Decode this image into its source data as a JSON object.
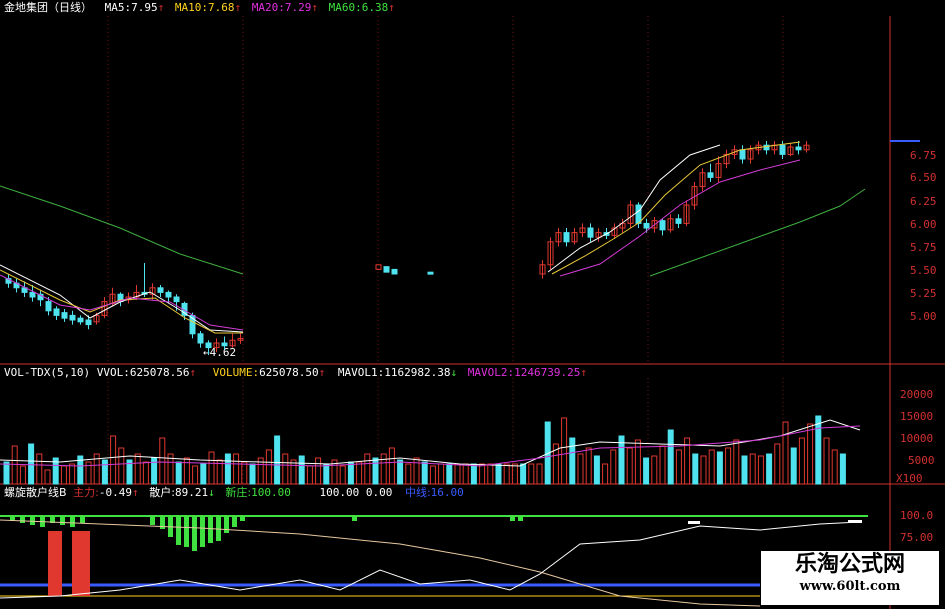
{
  "colors": {
    "up": "#e0382f",
    "down": "#4fe3ef",
    "ma5": "#ffffff",
    "ma10": "#e8c83a",
    "ma20": "#d33cd8",
    "ma60": "#3fae3f",
    "grid": "#7a1010",
    "text_white": "#ffffff",
    "text_yellow": "#ffd21e",
    "text_magenta": "#e030e0",
    "text_green": "#3fe03f",
    "text_blue": "#3a5bff",
    "axis_red": "#d23030"
  },
  "price_header": {
    "title": "金地集团（日线）",
    "ma5_label": "MA5:",
    "ma5_value": "7.95",
    "ma10_label": "MA10:",
    "ma10_value": "7.68",
    "ma20_label": "MA20:",
    "ma20_value": "7.29",
    "ma60_label": "MA60:",
    "ma60_value": "6.38"
  },
  "price_axis": {
    "ticks": [
      "6.75",
      "6.50",
      "6.25",
      "6.00",
      "5.75",
      "5.50",
      "5.25",
      "5.00"
    ]
  },
  "price_low_marker": "←4.62",
  "volume_header": {
    "indicator": "VOL-TDX(5,10)",
    "vvol_label": "VVOL:",
    "vvol_value": "625078.56",
    "volume_label": "VOLUME:",
    "volume_value": "625078.50",
    "mavol1_label": "MAVOL1:",
    "mavol1_value": "1162982.38",
    "mavol2_label": "MAVOL2:",
    "mavol2_value": "1246739.25"
  },
  "volume_axis": {
    "ticks": [
      "20000",
      "15000",
      "10000",
      "5000"
    ],
    "unit": "X100"
  },
  "spiral_header": {
    "name": "螺旋散户线B",
    "zhuli_label": "主力:",
    "zhuli_value": "-0.49",
    "sanhu_label": "散户:",
    "sanhu_value": "89.21",
    "xinzhuang_label": "新庄:",
    "xinzhuang_value": "100.00",
    "extra1_value": "100.00",
    "extra2_value": "0.00",
    "zhongxian_label": "中线:",
    "zhongxian_value": "16.00"
  },
  "spiral_axis": {
    "ticks": [
      "100.0",
      "75.00"
    ]
  },
  "watermark": {
    "title": "乐淘公式网",
    "url": "www.60lt.com"
  }
}
